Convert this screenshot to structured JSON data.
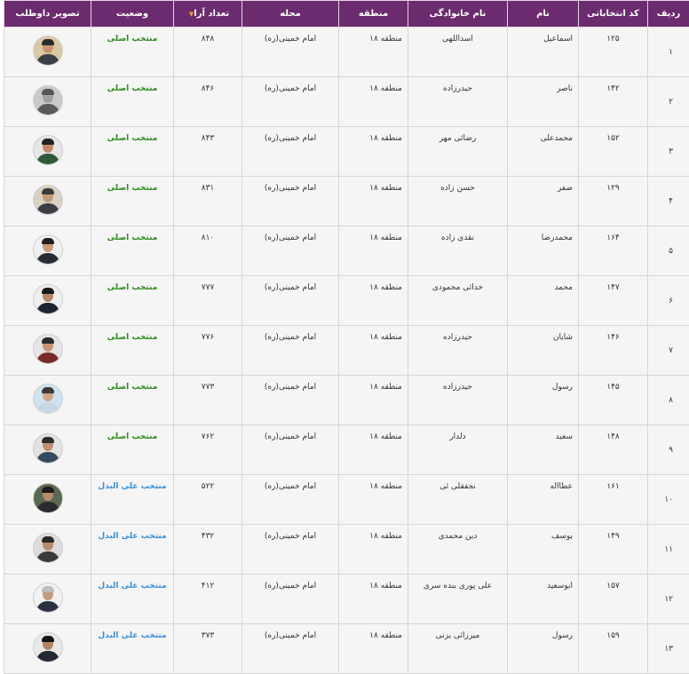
{
  "headers": {
    "row": "ردیف",
    "code": "کد انتخاباتی",
    "first": "نام",
    "last": "نام خانوادگی",
    "region": "منطقه",
    "place": "محله",
    "votes": "تعداد آرا",
    "status": "وضعیت",
    "photo": "تصویر داوطلب"
  },
  "sort_indicator": "▼",
  "rows": [
    {
      "idx": "۱",
      "code": "۱۲۵",
      "first": "اسماعیل",
      "last": "اسداللهی",
      "region": "منطقه ۱۸",
      "place": "امام خمینی(ره)",
      "votes": "۸۴۸",
      "status": "منتخب اصلی",
      "kind": "main",
      "bg": "#d8c9a3",
      "hair": "#2a2a2a",
      "skin": "#c79474",
      "suit": "#3a3f4a"
    },
    {
      "idx": "۲",
      "code": "۱۴۲",
      "first": "ناصر",
      "last": "حیدرزاده",
      "region": "منطقه ۱۸",
      "place": "امام خمینی(ره)",
      "votes": "۸۴۶",
      "status": "منتخب اصلی",
      "kind": "main",
      "bg": "#c9c9c9",
      "hair": "#555555",
      "skin": "#a0a0a0",
      "suit": "#5a5a5a"
    },
    {
      "idx": "۳",
      "code": "۱۵۲",
      "first": "محمدعلی",
      "last": "رضائی مهر",
      "region": "منطقه ۱۸",
      "place": "امام خمینی(ره)",
      "votes": "۸۴۳",
      "status": "منتخب اصلی",
      "kind": "main",
      "bg": "#e6e6e6",
      "hair": "#222222",
      "skin": "#c08a68",
      "suit": "#2e5a3a"
    },
    {
      "idx": "۴",
      "code": "۱۲۹",
      "first": "صفر",
      "last": "حسن زاده",
      "region": "منطقه ۱۸",
      "place": "امام خمینی(ره)",
      "votes": "۸۳۱",
      "status": "منتخب اصلی",
      "kind": "main",
      "bg": "#d9d2c0",
      "hair": "#3a3a3a",
      "skin": "#c49a7a",
      "suit": "#3d3d45"
    },
    {
      "idx": "۵",
      "code": "۱۶۴",
      "first": "محمدرضا",
      "last": "نقدی زاده",
      "region": "منطقه ۱۸",
      "place": "امام خمینی(ره)",
      "votes": "۸۱۰",
      "status": "منتخب اصلی",
      "kind": "main",
      "bg": "#f0f0f0",
      "hair": "#1e1e1e",
      "skin": "#c99a7a",
      "suit": "#262b35"
    },
    {
      "idx": "۶",
      "code": "۱۴۷",
      "first": "محمد",
      "last": "خدائی محمودی",
      "region": "منطقه ۱۸",
      "place": "امام خمینی(ره)",
      "votes": "۷۷۷",
      "status": "منتخب اصلی",
      "kind": "main",
      "bg": "#eeeeee",
      "hair": "#1a1a1a",
      "skin": "#b88766",
      "suit": "#1f2430"
    },
    {
      "idx": "۷",
      "code": "۱۴۶",
      "first": "شایان",
      "last": "حیدرزاده",
      "region": "منطقه ۱۸",
      "place": "امام خمینی(ره)",
      "votes": "۷۷۶",
      "status": "منتخب اصلی",
      "kind": "main",
      "bg": "#e4e4e4",
      "hair": "#2b2b2b",
      "skin": "#c99474",
      "suit": "#7a2a2a"
    },
    {
      "idx": "۸",
      "code": "۱۴۵",
      "first": "رسول",
      "last": "حیدرزاده",
      "region": "منطقه ۱۸",
      "place": "امام خمینی(ره)",
      "votes": "۷۷۳",
      "status": "منتخب اصلی",
      "kind": "main",
      "bg": "#cfe2f0",
      "hair": "#3a3a3a",
      "skin": "#d0a688",
      "suit": "#c8d6e2"
    },
    {
      "idx": "۹",
      "code": "۱۴۸",
      "first": "سعید",
      "last": "دلدار",
      "region": "منطقه ۱۸",
      "place": "امام خمینی(ره)",
      "votes": "۷۶۲",
      "status": "منتخب اصلی",
      "kind": "main",
      "bg": "#e2e2e2",
      "hair": "#2c2c2c",
      "skin": "#bf8f6f",
      "suit": "#34495e"
    },
    {
      "idx": "۱۰",
      "code": "۱۶۱",
      "first": "عطااله",
      "last": "نجفقلی ئی",
      "region": "منطقه ۱۸",
      "place": "امام خمینی(ره)",
      "votes": "۵۲۲",
      "status": "منتخب علی البدل",
      "kind": "alt",
      "bg": "#5a6a52",
      "hair": "#1c1c1c",
      "skin": "#b98a6a",
      "suit": "#2a2a30"
    },
    {
      "idx": "۱۱",
      "code": "۱۴۹",
      "first": "یوسف",
      "last": "دین محمدی",
      "region": "منطقه ۱۸",
      "place": "امام خمینی(ره)",
      "votes": "۴۳۲",
      "status": "منتخب علی البدل",
      "kind": "alt",
      "bg": "#dcdcdc",
      "hair": "#2a2a2a",
      "skin": "#b88a6c",
      "suit": "#3a3a3a"
    },
    {
      "idx": "۱۲",
      "code": "۱۵۷",
      "first": "ابوسعید",
      "last": "علی پوری بنده سری",
      "region": "منطقه ۱۸",
      "place": "امام خمینی(ره)",
      "votes": "۴۱۲",
      "status": "منتخب علی البدل",
      "kind": "alt",
      "bg": "#f2f2f2",
      "hair": "#bdbdbd",
      "skin": "#c49a7c",
      "suit": "#2b3140"
    },
    {
      "idx": "۱۳",
      "code": "۱۵۹",
      "first": "رسول",
      "last": "میرزائی یزنی",
      "region": "منطقه ۱۸",
      "place": "امام خمینی(ره)",
      "votes": "۳۷۳",
      "status": "منتخب علی البدل",
      "kind": "alt",
      "bg": "#e8e8e8",
      "hair": "#151515",
      "skin": "#b48565",
      "suit": "#232833"
    }
  ]
}
